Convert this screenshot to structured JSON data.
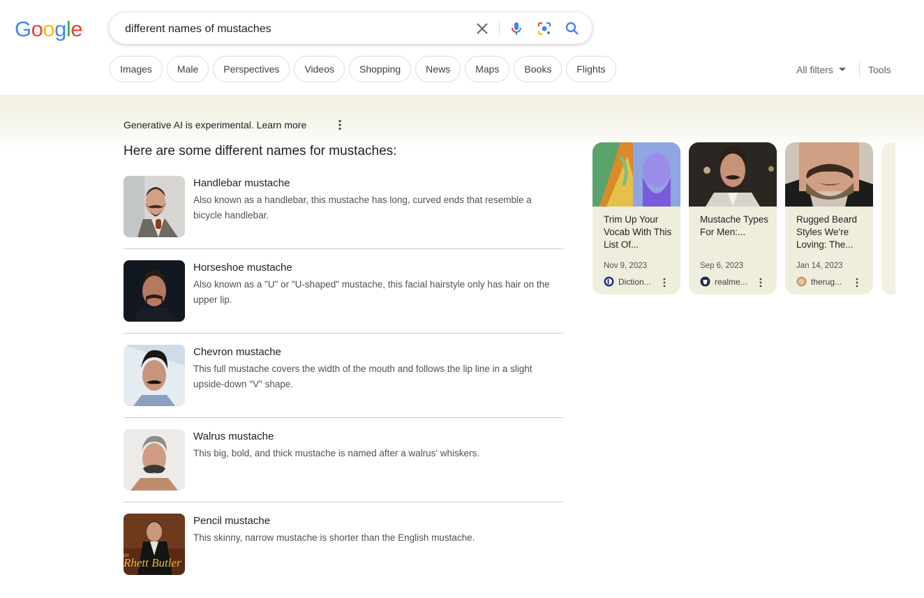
{
  "logo": {
    "letters": [
      "G",
      "o",
      "o",
      "g",
      "l",
      "e"
    ],
    "colors": [
      "#4285F4",
      "#EA4335",
      "#FBBC05",
      "#4285F4",
      "#34A853",
      "#EA4335"
    ]
  },
  "search": {
    "query": "different names of mustaches"
  },
  "chips": [
    "Images",
    "Male",
    "Perspectives",
    "Videos",
    "Shopping",
    "News",
    "Maps",
    "Books",
    "Flights"
  ],
  "filters": {
    "all_filters": "All filters",
    "tools": "Tools"
  },
  "ai": {
    "note_bold": "Generative AI is experimental.",
    "note_link": "Learn more",
    "heading": "Here are some different names for mustaches:"
  },
  "items": [
    {
      "title": "Handlebar mustache",
      "desc": "Also known as a handlebar, this mustache has long, curved ends that resemble a bicycle handlebar."
    },
    {
      "title": "Horseshoe mustache",
      "desc": "Also known as a \"U\" or \"U-shaped\" mustache, this facial hairstyle only has hair on the upper lip."
    },
    {
      "title": "Chevron mustache",
      "desc": "This full mustache covers the width of the mouth and follows the lip line in a slight upside-down \"V\" shape."
    },
    {
      "title": "Walrus mustache",
      "desc": "This big, bold, and thick mustache is named after a walrus' whiskers."
    },
    {
      "title": "Pencil mustache",
      "desc": "This skinny, narrow mustache is shorter than the English mustache.",
      "thumb_caption": "Rhett Butler",
      "thumb_caption_small": "as"
    }
  ],
  "cards": [
    {
      "title": "Trim Up Your Vocab With This List Of...",
      "date": "Nov 9, 2023",
      "source": "Diction..."
    },
    {
      "title": "Mustache Types For Men:...",
      "date": "Sep 6, 2023",
      "source": "realme..."
    },
    {
      "title": "Rugged Beard Styles We're Loving: The...",
      "date": "Jan 14, 2023",
      "source": "therug..."
    }
  ]
}
